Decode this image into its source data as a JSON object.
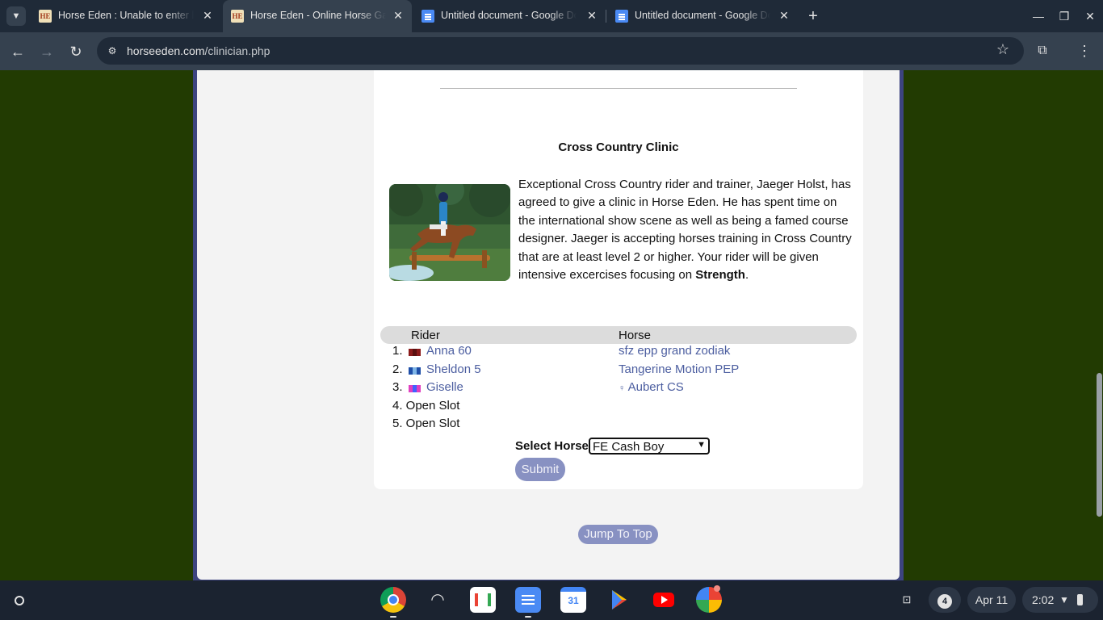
{
  "browser": {
    "tabs": [
      {
        "title": "Horse Eden : Unable to enter horse",
        "favicon": "horse-eden",
        "active": false
      },
      {
        "title": "Horse Eden - Online Horse Game",
        "favicon": "horse-eden",
        "active": true
      },
      {
        "title": "Untitled document - Google Docs",
        "favicon": "google-docs",
        "active": false
      },
      {
        "title": "Untitled document - Google Docs",
        "favicon": "google-docs",
        "active": false
      }
    ],
    "url_host": "horseeden.com",
    "url_path": "/clinician.php"
  },
  "clinic": {
    "title": "Cross Country Clinic",
    "description": "Exceptional Cross Country rider and trainer, Jaeger Holst, has agreed to give a clinic in Horse Eden. He has spent time on the international show scene as well as being a famed course designer. Jaeger is accepting horses training in Cross Country that are at least level 2 or higher. Your rider will be given intensive excercises focusing on ",
    "focus": "Strength",
    "focus_suffix": ".",
    "table": {
      "rider_header": "Rider",
      "horse_header": "Horse",
      "entries": [
        {
          "num": "1.",
          "rider": "Anna 60",
          "horse": "sfz epp grand zodiak",
          "flag_colors": [
            "#8b1a1a",
            "#5a0f0f"
          ]
        },
        {
          "num": "2.",
          "rider": "Sheldon 5",
          "horse": "Tangerine Motion PEP",
          "flag_colors": [
            "#1f4fa8",
            "#7fb6e8"
          ]
        },
        {
          "num": "3.",
          "rider": "Giselle",
          "horse": "Aubert CS",
          "horse_glyph": "♀",
          "flag_colors": [
            "#e040c0",
            "#4060ff"
          ]
        }
      ],
      "open_slots": [
        "4. Open Slot",
        "5. Open Slot"
      ]
    },
    "select_label": "Select Horse",
    "selected_horse": "FE Cash Boy",
    "submit_label": "Submit"
  },
  "page": {
    "jump_label": "Jump To Top"
  },
  "shelf": {
    "notification_count": "4",
    "date": "Apr 11",
    "time": "2:02"
  },
  "colors": {
    "page_background": "#223b02",
    "frame": "#3d4480",
    "link": "#4c5ea0",
    "button": "#8891c2"
  }
}
